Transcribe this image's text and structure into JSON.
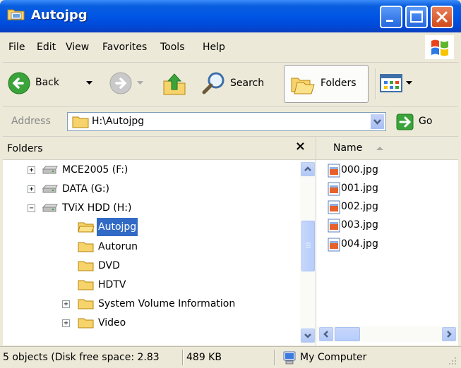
{
  "window": {
    "title": "Autojpg"
  },
  "menu": [
    "File",
    "Edit",
    "View",
    "Favorites",
    "Tools",
    "Help"
  ],
  "toolbar": {
    "back": "Back",
    "search": "Search",
    "folders": "Folders"
  },
  "address": {
    "label": "Address",
    "value": "H:\\Autojpg",
    "go": "Go"
  },
  "folders_pane": {
    "title": "Folders",
    "close": "×",
    "tree": [
      {
        "label": "MCE2005 (F:)",
        "type": "drive",
        "expander": "+"
      },
      {
        "label": "DATA (G:)",
        "type": "drive",
        "expander": "+"
      },
      {
        "label": "TViX HDD (H:)",
        "type": "drive",
        "expander": "−"
      },
      {
        "label": "Autojpg",
        "type": "folder",
        "selected": true
      },
      {
        "label": "Autorun",
        "type": "folder"
      },
      {
        "label": "DVD",
        "type": "folder"
      },
      {
        "label": "HDTV",
        "type": "folder"
      },
      {
        "label": "System Volume Information",
        "type": "folder",
        "expander": "+"
      },
      {
        "label": "Video",
        "type": "folder",
        "expander": "+"
      }
    ]
  },
  "file_list": {
    "column": "Name",
    "sort": "ascending",
    "files": [
      "000.jpg",
      "001.jpg",
      "002.jpg",
      "003.jpg",
      "004.jpg"
    ]
  },
  "status": {
    "objects": "5 objects (Disk free space: 2.83",
    "size": "489 KB",
    "location": "My Computer"
  },
  "colors": {
    "titlebar": "#0055e5",
    "selection": "#316ac5",
    "chrome": "#ece9d8"
  }
}
